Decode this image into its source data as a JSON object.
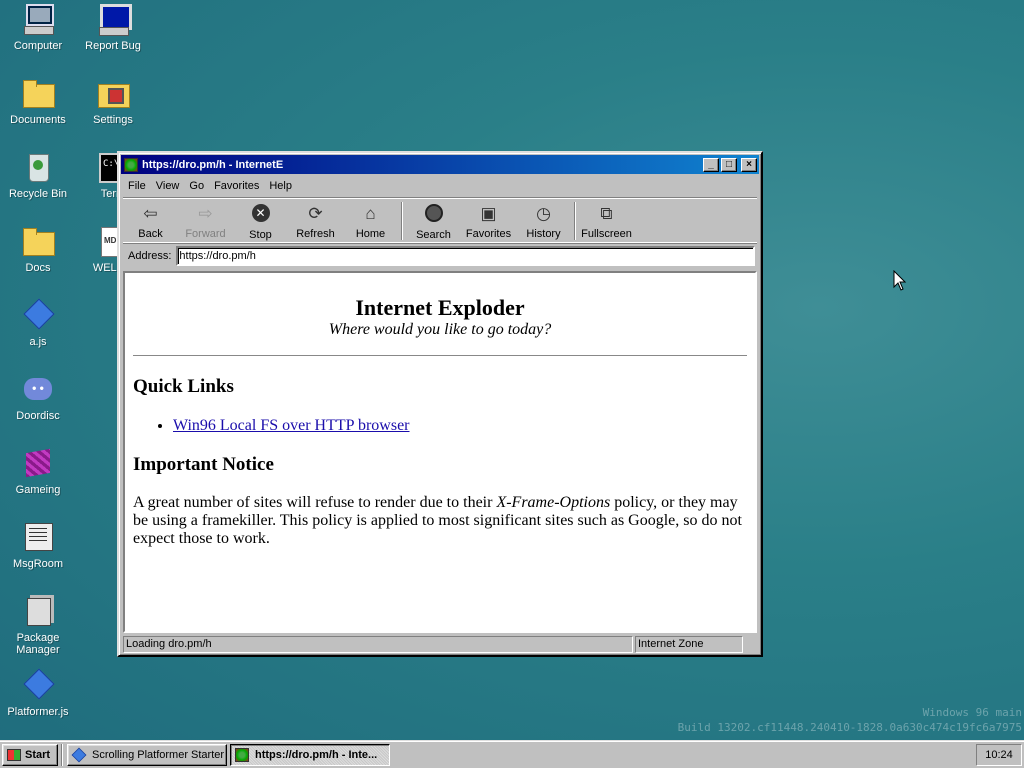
{
  "desktop": {
    "icons": [
      {
        "label": "Computer",
        "icon": "computer-icon"
      },
      {
        "label": "Report Bug",
        "icon": "monitor-icon"
      },
      {
        "label": "Documents",
        "icon": "folder-icon"
      },
      {
        "label": "Settings",
        "icon": "settings-icon"
      },
      {
        "label": "Recycle Bin",
        "icon": "recycle-bin-icon"
      },
      {
        "label": "Term",
        "icon": "terminal-icon"
      },
      {
        "label": "Docs",
        "icon": "folder-icon"
      },
      {
        "label": "WELCO",
        "icon": "document-icon"
      },
      {
        "label": "a.js",
        "icon": "diamond-icon"
      },
      {
        "label": "Doordisc",
        "icon": "discord-icon"
      },
      {
        "label": "Gameing",
        "icon": "cube-icon"
      },
      {
        "label": "MsgRoom",
        "icon": "message-icon"
      },
      {
        "label": "Package\nManager",
        "icon": "package-icon"
      },
      {
        "label": "Platformer.js",
        "icon": "diamond-icon"
      }
    ],
    "watermark": {
      "line1": "Windows 96 main",
      "line2": "Build 13202.cf11448.240410-1828.0a630c474c19fc6a7975"
    }
  },
  "browser": {
    "title": "https://dro.pm/h - InternetE",
    "menu": [
      "File",
      "View",
      "Go",
      "Favorites",
      "Help"
    ],
    "toolbar": {
      "back": "Back",
      "forward": "Forward",
      "stop": "Stop",
      "refresh": "Refresh",
      "home": "Home",
      "search": "Search",
      "favorites": "Favorites",
      "history": "History",
      "fullscreen": "Fullscreen"
    },
    "address_label": "Address:",
    "address_value": "https://dro.pm/h",
    "page": {
      "heading": "Internet Exploder",
      "subtitle": "Where would you like to go today?",
      "quick_links_heading": "Quick Links",
      "links": [
        "Win96 Local FS over HTTP browser"
      ],
      "notice_heading": "Important Notice",
      "notice_part1": "A great number of sites will refuse to render due to their ",
      "notice_emph": "X-Frame-Options",
      "notice_part2": " policy, or they may be using a framekiller. This policy is applied to most significant sites such as Google, so do not expect those to work."
    },
    "status": {
      "left": "Loading dro.pm/h",
      "zone": "Internet Zone"
    }
  },
  "taskbar": {
    "start": "Start",
    "tasks": [
      {
        "label": "Scrolling Platformer Starter",
        "active": false
      },
      {
        "label": "https://dro.pm/h - Inte...",
        "active": true
      }
    ],
    "clock": "10:24"
  }
}
